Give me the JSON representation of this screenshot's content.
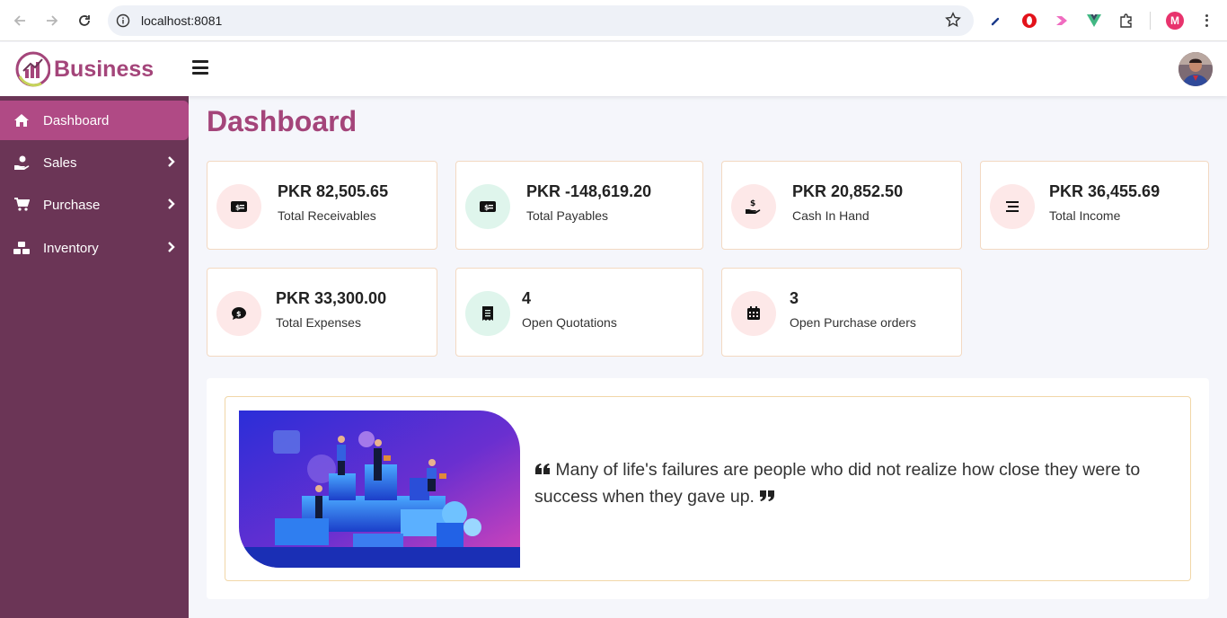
{
  "browser": {
    "url": "localhost:8081",
    "profile_initial": "M"
  },
  "app": {
    "logo_text": "Business"
  },
  "sidebar": {
    "items": [
      {
        "label": "Dashboard",
        "icon": "home-icon",
        "active": true
      },
      {
        "label": "Sales",
        "icon": "hand-coin-icon",
        "active": false
      },
      {
        "label": "Purchase",
        "icon": "cart-icon",
        "active": false
      },
      {
        "label": "Inventory",
        "icon": "boxes-icon",
        "active": false
      }
    ]
  },
  "page": {
    "title": "Dashboard"
  },
  "cards": [
    {
      "value": "PKR 82,505.65",
      "label": "Total Receivables",
      "icon": "money-bill-icon"
    },
    {
      "value": "PKR -148,619.20",
      "label": "Total Payables",
      "icon": "money-bill-icon"
    },
    {
      "value": "PKR 20,852.50",
      "label": "Cash In Hand",
      "icon": "hand-dollar-icon"
    },
    {
      "value": "PKR 36,455.69",
      "label": "Total Income",
      "icon": "lines-icon"
    },
    {
      "value": "PKR 33,300.00",
      "label": "Total Expenses",
      "icon": "dollar-chat-icon"
    },
    {
      "value": "4",
      "label": "Open Quotations",
      "icon": "receipt-icon"
    },
    {
      "value": "3",
      "label": "Open Purchase orders",
      "icon": "calendar-icon"
    }
  ],
  "quote": {
    "text": "Many of life's failures are people who did not realize how close they were to success when they gave up."
  },
  "colors": {
    "brand": "#a4457a",
    "sidebar_bg": "#6b3556",
    "sidebar_active": "#b04a85",
    "card_border": "#f3d9c2"
  }
}
